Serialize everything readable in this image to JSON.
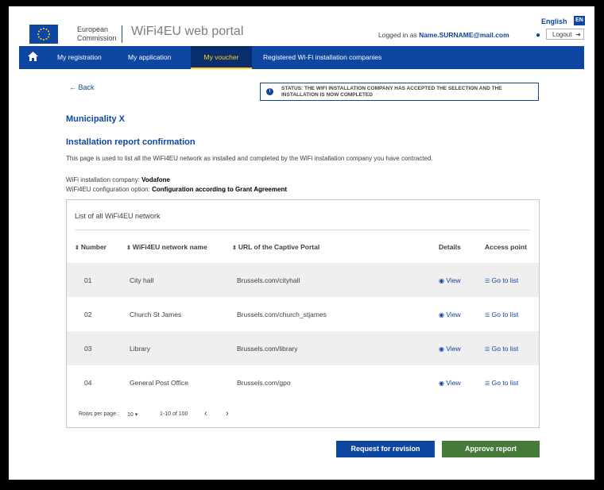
{
  "header": {
    "logo_line1": "European",
    "logo_line2": "Commission",
    "portal_title": "WiFi4EU web portal",
    "language": "English",
    "language_code": "EN",
    "logged_in_prefix": "Logged in as",
    "user_email": "Name.SURNAME@mail.com",
    "logout_label": "Logout"
  },
  "nav": {
    "items": [
      {
        "label": "My registration"
      },
      {
        "label": "My application"
      },
      {
        "label": "My voucher"
      },
      {
        "label": "Registered Wi-Fi installation companies"
      }
    ],
    "active_index": 2
  },
  "page": {
    "back_label": "← Back",
    "status_text": "STATUS: THE WIFI INSTALLATION COMPANY HAS ACCEPTED THE SELECTION AND THE INSTALLATION IS NOW COMPLETED",
    "municipality": "Municipality X",
    "section_title": "Installation report confirmation",
    "description": "This page is used to list all the WiFi4EU network as installed and completed by the WiFi installation company you have contracted.",
    "company_label": "WiFi installation company:",
    "company_value": "Vodafone",
    "config_label": "WiFi4EU configuration option:",
    "config_value": "Configuration according to Grant Agreement"
  },
  "table": {
    "title": "List of all WiFi4EU network",
    "headers": {
      "number": "Number",
      "name": "WiFi4EU network name",
      "url": "URL of the Captive Portal",
      "details": "Details",
      "access": "Access point"
    },
    "rows": [
      {
        "number": "01",
        "name": "City hall",
        "url": "Brussels.com/cityhall",
        "details": "View",
        "access": "Go to list"
      },
      {
        "number": "02",
        "name": "Church St James",
        "url": "Brussels.com/church_stjames",
        "details": "View",
        "access": "Go to list"
      },
      {
        "number": "03",
        "name": "Library",
        "url": "Brussels.com/library",
        "details": "View",
        "access": "Go to list"
      },
      {
        "number": "04",
        "name": "General Post Office",
        "url": "Brussels.com/gpo",
        "details": "View",
        "access": "Go to list"
      }
    ],
    "pager": {
      "rows_per_page_label": "Rows per page :",
      "rows_per_page_value": "10 ▾",
      "range": "1-10 of 100",
      "prev": "‹",
      "next": "›"
    }
  },
  "actions": {
    "revision_label": "Request for revision",
    "approve_label": "Approve report"
  },
  "colors": {
    "brand_blue": "#0e47a1",
    "approve_green": "#467a39",
    "active_tab_accent": "#ffd617"
  }
}
